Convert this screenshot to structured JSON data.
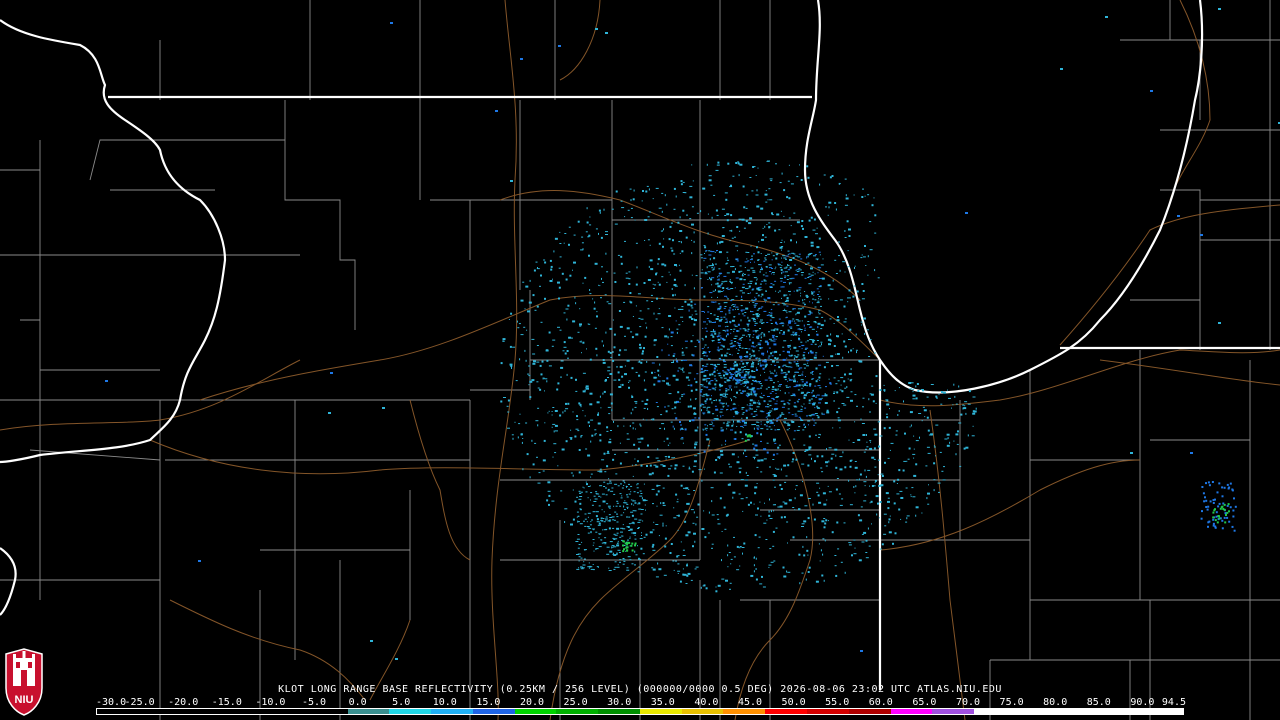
{
  "product": {
    "title": "KLOT LONG RANGE BASE REFLECTIVITY (0.25KM / 256 LEVEL) (000000/0000 0.5 DEG) 2026-08-06 23:02 UTC  ATLAS.NIU.EDU"
  },
  "scale": {
    "labels": [
      "-30.0",
      "-25.0",
      "-20.0",
      "-15.0",
      "-10.0",
      "-5.0",
      "0.0",
      "5.0",
      "10.0",
      "15.0",
      "20.0",
      "25.0",
      "30.0",
      "35.0",
      "40.0",
      "45.0",
      "50.0",
      "55.0",
      "60.0",
      "65.0",
      "70.0",
      "75.0",
      "80.0",
      "85.0",
      "90.0",
      "94.5"
    ],
    "colors": [
      "#000000",
      "#000000",
      "#000000",
      "#000000",
      "#000000",
      "#000000",
      "#3a8f8f",
      "#1fd6e6",
      "#1fb0f5",
      "#1e64e6",
      "#00d400",
      "#00b000",
      "#009000",
      "#e8e800",
      "#e8c000",
      "#ff9000",
      "#ff0000",
      "#d40000",
      "#b00000",
      "#ff00ff",
      "#a050e0",
      "#ffffff",
      "#ffffff",
      "#ffffff",
      "#ffffff",
      "#ffffff"
    ]
  },
  "logo": {
    "text": "NIU"
  },
  "colors": {
    "state_border": "#ffffff",
    "county_border": "#8a8a8a",
    "highway": "#8b5a2b",
    "echo_light": "#2fb5d8",
    "echo_mid": "#1e78e6",
    "echo_strong": "#22c84a"
  }
}
